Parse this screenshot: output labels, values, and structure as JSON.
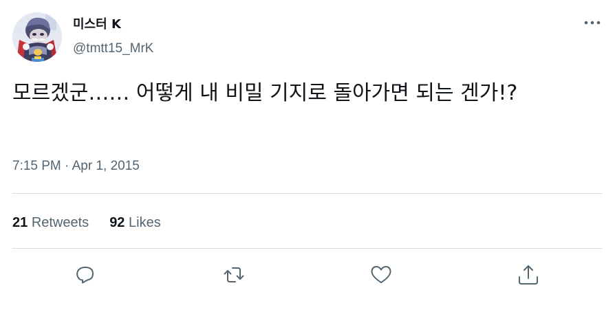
{
  "user": {
    "display_name": "미스터 K",
    "handle": "@tmtt15_MrK",
    "avatar_icon": "profile-avatar"
  },
  "menu": {
    "icon": "more-horizontal-icon"
  },
  "tweet": {
    "text": "모르겠군…… 어떻게 내 비밀 기지로 돌아가면 되는 겐가!?",
    "time": "7:15 PM",
    "separator": "·",
    "date": "Apr 1, 2015"
  },
  "stats": {
    "retweets_count": "21",
    "retweets_label": "Retweets",
    "likes_count": "92",
    "likes_label": "Likes"
  },
  "actions": {
    "reply_icon": "reply-icon",
    "retweet_icon": "retweet-icon",
    "like_icon": "heart-icon",
    "share_icon": "share-icon"
  },
  "colors": {
    "text_primary": "#0f1419",
    "text_secondary": "#536471",
    "divider": "#d9dee2"
  }
}
